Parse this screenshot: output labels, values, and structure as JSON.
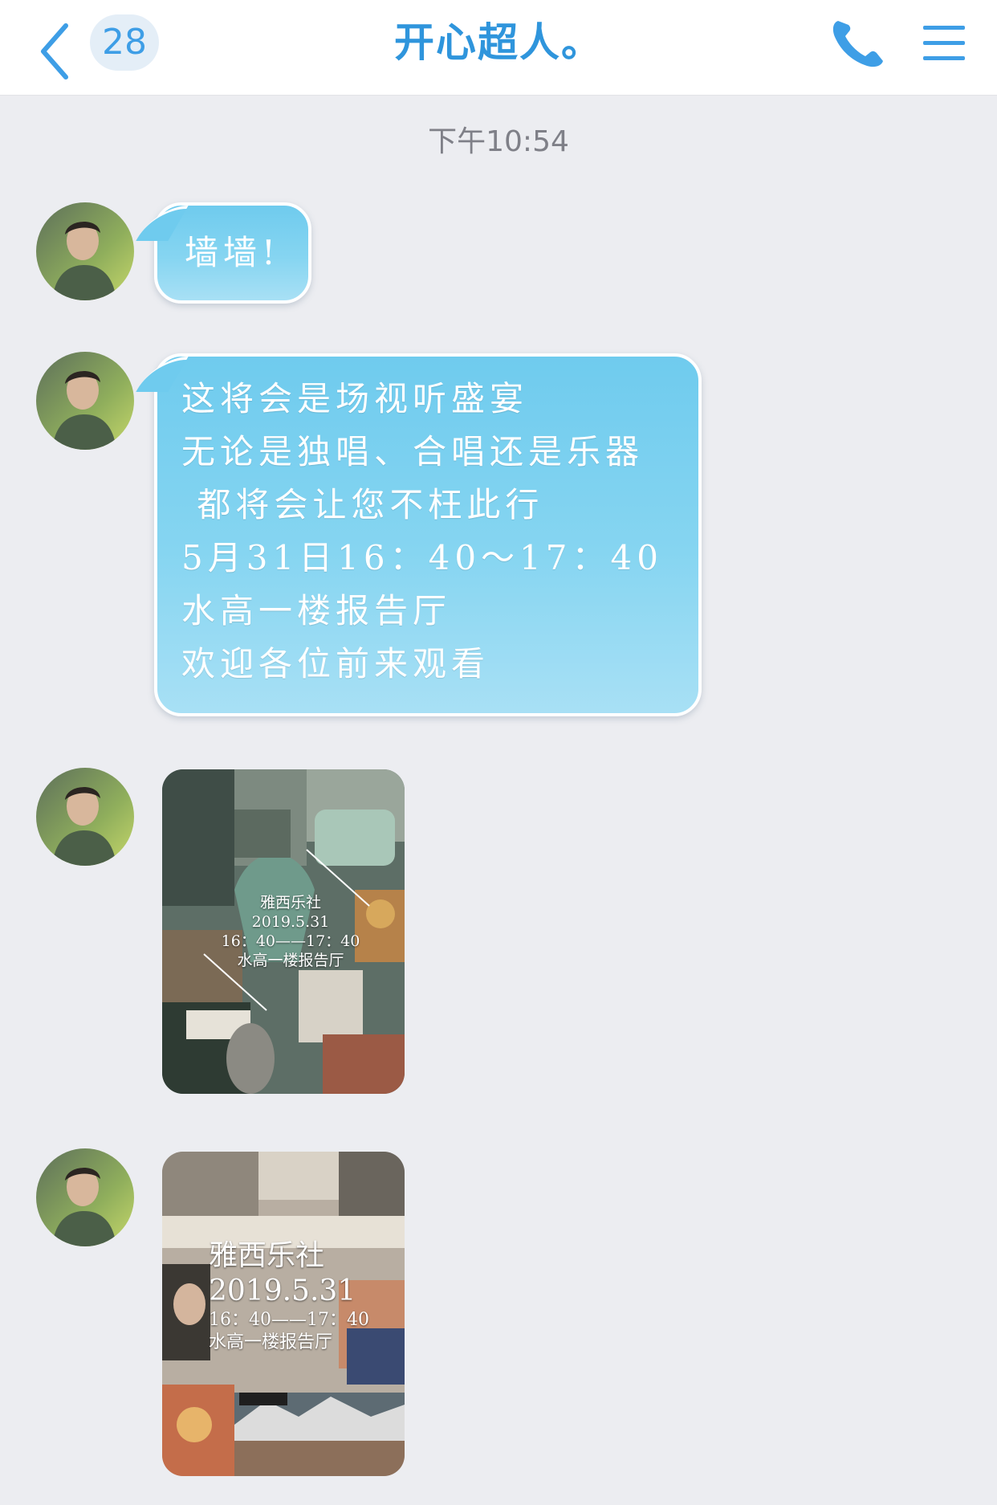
{
  "header": {
    "back_icon": "chevron-left-icon",
    "unread_count": "28",
    "title": "开心超人。",
    "call_icon": "phone-icon",
    "menu_icon": "hamburger-menu-icon",
    "accent_color": "#2f95dc"
  },
  "conversation": {
    "timestamp": "下午10:54",
    "bubble_color": "#7fd1f0",
    "messages": [
      {
        "type": "text",
        "text": "墙墙!"
      },
      {
        "type": "text",
        "lines": [
          "这将会是场视听盛宴",
          "无论是独唱、合唱还是乐器",
          " 都将会让您不枉此行",
          "5月31日16：40～17：40",
          "水高一楼报告厅",
          "欢迎各位前来观看"
        ]
      },
      {
        "type": "image",
        "poster": {
          "club": "雅西乐社",
          "date": "2019.5.31",
          "time": "16：40——17：40",
          "venue": "水高一楼报告厅"
        }
      },
      {
        "type": "image",
        "poster": {
          "club": "雅西乐社",
          "date": "2019.5.31",
          "time": "16：40——17：40",
          "venue": "水高一楼报告厅"
        }
      }
    ]
  }
}
